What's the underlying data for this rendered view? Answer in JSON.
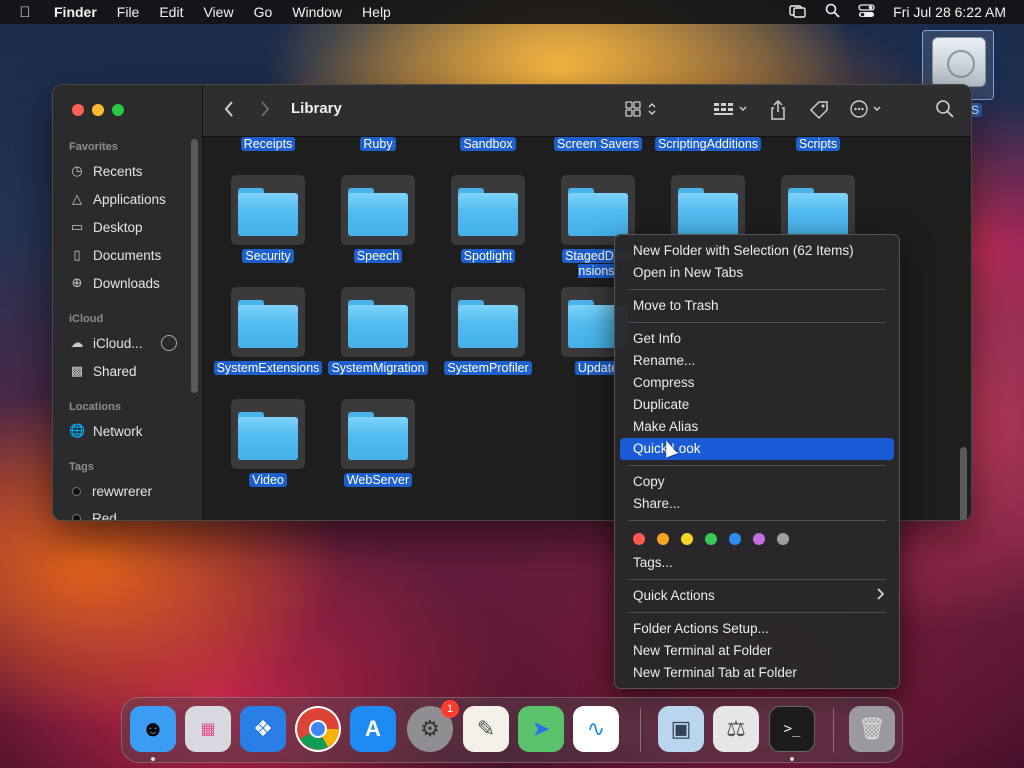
{
  "menubar": {
    "apple_icon": "apple-logo-icon",
    "app_name": "Finder",
    "menus": [
      "File",
      "Edit",
      "View",
      "Go",
      "Window",
      "Help"
    ],
    "status_icons": [
      "screen-mirroring-icon",
      "spotlight-search-icon",
      "control-center-icon"
    ],
    "clock": "Fri Jul 28  6:22 AM"
  },
  "desktop": {
    "drive_label_fragment": "S"
  },
  "finder": {
    "title": "Library",
    "sidebar": {
      "sections": {
        "favorites": "Favorites",
        "icloud": "iCloud",
        "locations": "Locations",
        "tags": "Tags"
      },
      "favorites": [
        {
          "label": "Recents",
          "icon": "clock-icon"
        },
        {
          "label": "Applications",
          "icon": "applications-icon"
        },
        {
          "label": "Desktop",
          "icon": "desktop-icon"
        },
        {
          "label": "Documents",
          "icon": "document-icon"
        },
        {
          "label": "Downloads",
          "icon": "download-icon"
        }
      ],
      "icloud": [
        {
          "label": "iCloud...",
          "icon": "cloud-icon"
        },
        {
          "label": "Shared",
          "icon": "shared-folder-icon"
        }
      ],
      "locations": [
        {
          "label": "Network",
          "icon": "network-globe-icon"
        }
      ],
      "tags": [
        {
          "label": "rewwrerer"
        },
        {
          "label": "Red"
        }
      ]
    },
    "partial_row_labels": [
      "Receipts",
      "Ruby",
      "Sandbox",
      "Screen Savers",
      "ScriptingAdditions",
      "Scripts"
    ],
    "folders": [
      {
        "label": "Security"
      },
      {
        "label": "Speech"
      },
      {
        "label": "Spotlight"
      },
      {
        "label": "StagedDrive\nnsions"
      },
      {
        "label": ""
      },
      {
        "label": ""
      },
      {
        "label": "SystemExtensions"
      },
      {
        "label": "SystemMigration"
      },
      {
        "label": "SystemProfiler"
      },
      {
        "label": "Update"
      },
      {
        "label": "Video"
      },
      {
        "label": "WebServer"
      }
    ]
  },
  "context_menu": {
    "groups": [
      [
        "New Folder with Selection (62 Items)",
        "Open in New Tabs"
      ],
      [
        "Move to Trash"
      ],
      [
        "Get Info",
        "Rename...",
        "Compress",
        "Duplicate",
        "Make Alias",
        "Quick Look"
      ],
      [
        "Copy",
        "Share..."
      ]
    ],
    "highlighted": "Quick Look",
    "tag_colors": [
      "#ff5a52",
      "#f6a623",
      "#f5d327",
      "#3ac856",
      "#2f8cf0",
      "#c26de0",
      "#a0a0a0"
    ],
    "tags_item": "Tags...",
    "quick_actions": "Quick Actions",
    "tail": [
      "Folder Actions Setup...",
      "New Terminal at Folder",
      "New Terminal Tab at Folder"
    ]
  },
  "dock": {
    "apps": [
      {
        "name": "Finder",
        "icon": "finder-icon",
        "color": "#3a9cf2"
      },
      {
        "name": "Launchpad",
        "icon": "launchpad-icon",
        "color": "#d8d8e0"
      },
      {
        "name": "Safari",
        "icon": "safari-icon",
        "color": "#2a7fe6"
      },
      {
        "name": "Chrome",
        "icon": "chrome-icon",
        "color": "#ffffff"
      },
      {
        "name": "App Store",
        "icon": "app-store-icon",
        "color": "#1d8bf2"
      },
      {
        "name": "System Settings",
        "icon": "settings-gear-icon",
        "color": "#8e8e93",
        "badge": "1"
      },
      {
        "name": "TextEdit",
        "icon": "textedit-icon",
        "color": "#f4f1e8"
      },
      {
        "name": "Maps",
        "icon": "maps-icon",
        "color": "#59c26b"
      },
      {
        "name": "Freeform",
        "icon": "freeform-icon",
        "color": "#ffffff"
      },
      {
        "name": "Preview",
        "icon": "preview-icon",
        "color": "#b9d6ee"
      },
      {
        "name": "System Information",
        "icon": "system-info-icon",
        "color": "#e6e6e6"
      },
      {
        "name": "Terminal",
        "icon": "terminal-icon",
        "color": "#1c1c1c"
      },
      {
        "name": "Trash",
        "icon": "trash-icon",
        "color": "#9a9aa0"
      }
    ]
  }
}
